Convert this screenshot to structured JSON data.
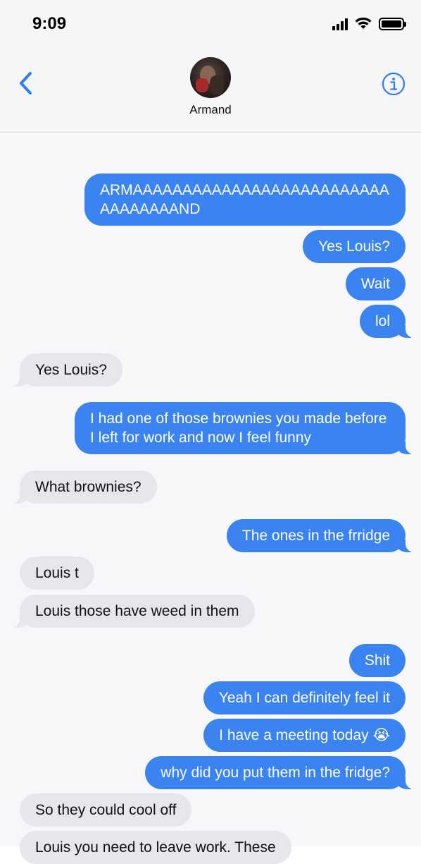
{
  "status_bar": {
    "time": "9:09"
  },
  "header": {
    "contact_name": "Armand"
  },
  "messages": [
    {
      "from": "me",
      "text": "ARMAAAAAAAAAAAAAAAAAAAAAAAAAAAAAAAAAAND"
    },
    {
      "from": "me",
      "text": "Yes Louis?"
    },
    {
      "from": "me",
      "text": "Wait"
    },
    {
      "from": "me",
      "text": "lol"
    },
    {
      "from": "them",
      "text": "Yes Louis?"
    },
    {
      "from": "me",
      "text": "I had one of those brownies you made before I left for work and now I feel funny"
    },
    {
      "from": "them",
      "text": "What brownies?"
    },
    {
      "from": "me",
      "text": "The ones in the frridge"
    },
    {
      "from": "them",
      "text": "Louis t"
    },
    {
      "from": "them",
      "text": "Louis those have weed in them"
    },
    {
      "from": "me",
      "text": "Shit"
    },
    {
      "from": "me",
      "text": "Yeah I can definitely feel it"
    },
    {
      "from": "me",
      "text": "I have a meeting today 😭"
    },
    {
      "from": "me",
      "text": "why did you put them in the fridge?"
    },
    {
      "from": "them",
      "text": "So they could cool off"
    },
    {
      "from": "them",
      "text": "Louis you need to leave work. These"
    }
  ],
  "colors": {
    "sent": "#3a83f1",
    "received": "#e7e6eb",
    "accent": "#2f7cf6"
  },
  "icons": {
    "back": "chevron-left-icon",
    "info": "info-icon"
  }
}
